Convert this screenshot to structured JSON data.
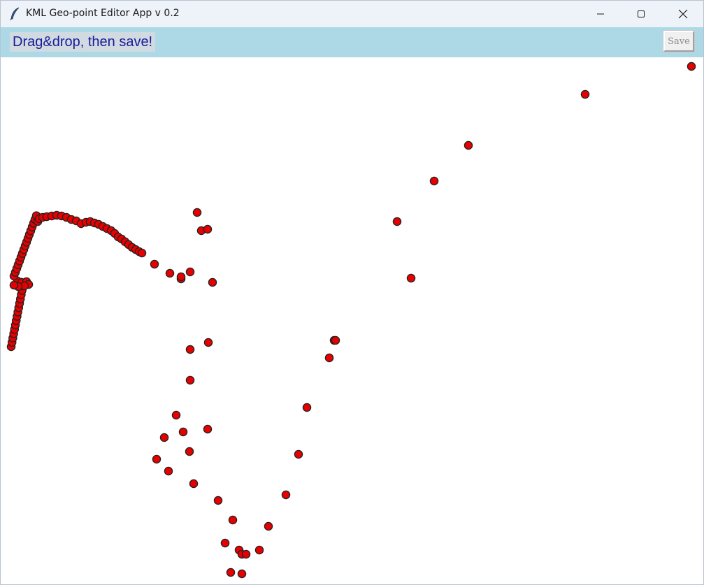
{
  "window": {
    "title": "KML Geo-point Editor App v 0.2",
    "icon": "feather-icon",
    "controls": [
      "minimize-icon",
      "maximize-icon",
      "close-icon"
    ]
  },
  "toolbar": {
    "instruction": "Drag&drop, then save!",
    "save_label": "Save",
    "background": "#add8e6",
    "instruction_color": "#1b1b98"
  },
  "canvas": {
    "background": "#ffffff",
    "point_color": "#e60000",
    "point_outline": "#222222"
  }
}
